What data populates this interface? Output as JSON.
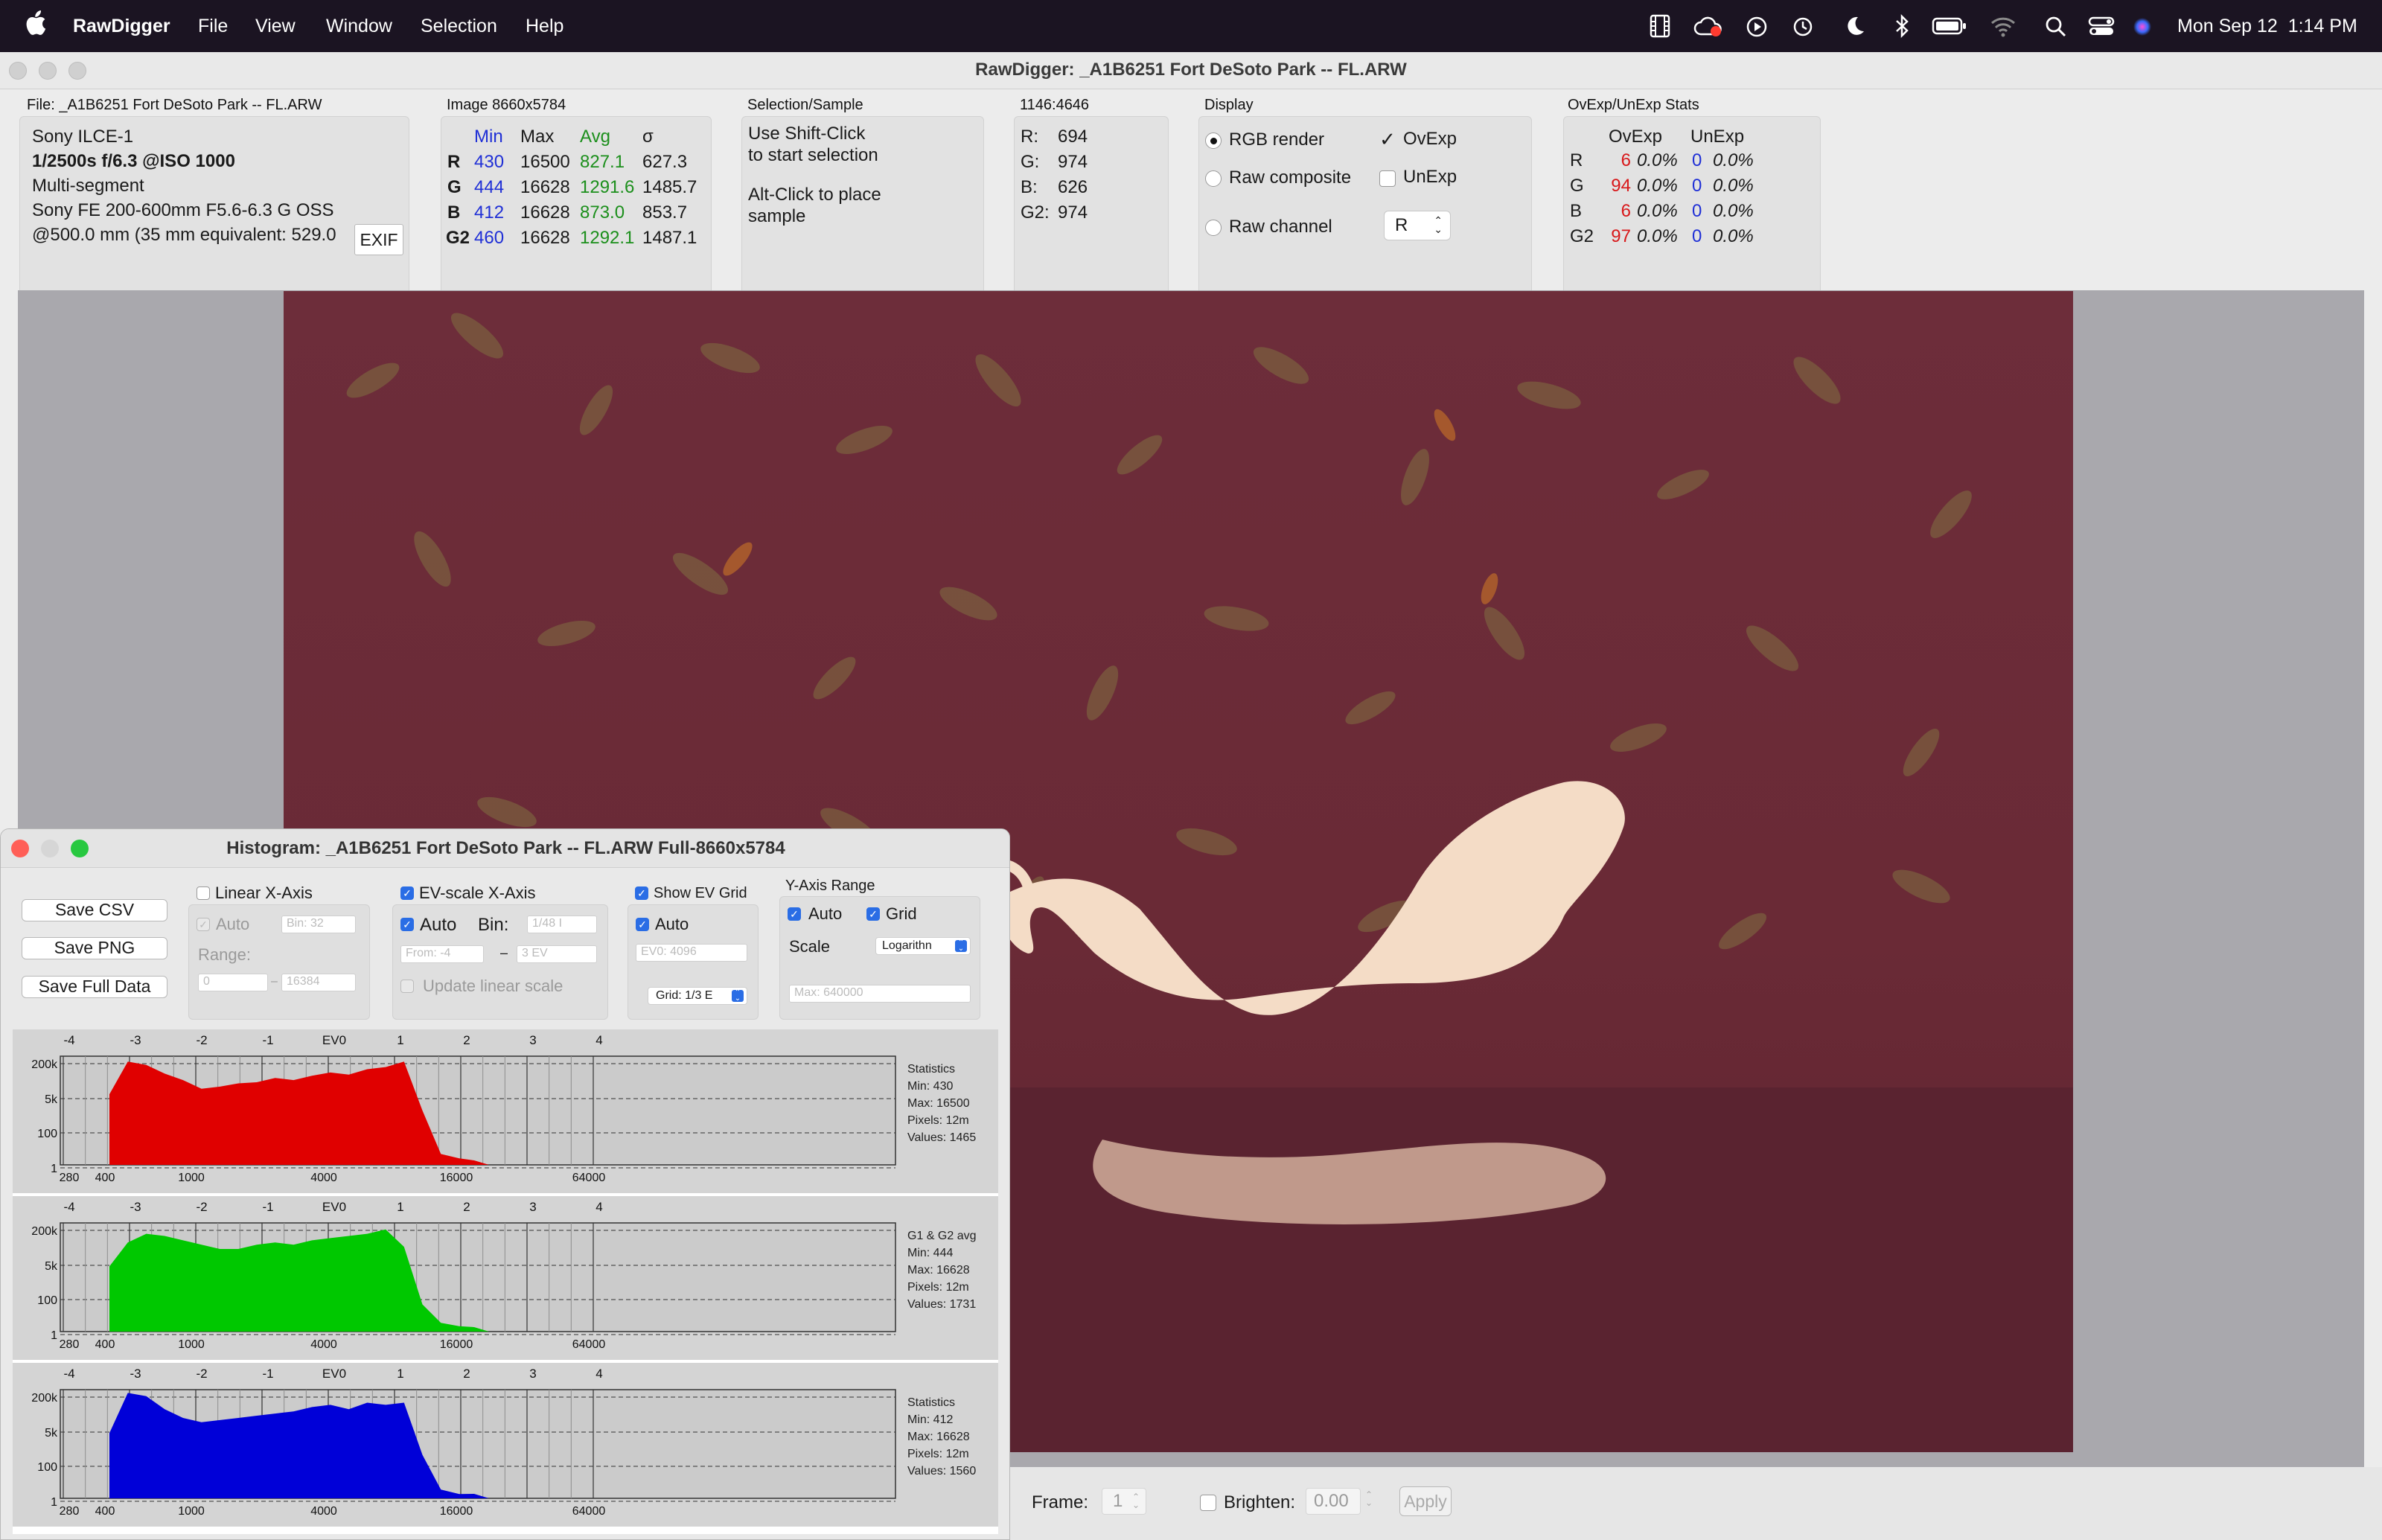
{
  "menubar": {
    "app": "RawDigger",
    "menus": [
      "File",
      "View",
      "Window",
      "Selection",
      "Help"
    ],
    "clock": "Mon Sep 12  1:14 PM"
  },
  "main": {
    "title": "RawDigger: _A1B6251 Fort DeSoto Park -- FL.ARW",
    "file_label": "File: _A1B6251 Fort DeSoto Park -- FL.ARW",
    "camera": "Sony ILCE-1",
    "exposure": "1/2500s f/6.3 @ISO 1000",
    "segment": "Multi-segment",
    "lens": "Sony FE 200-600mm F5.6-6.3 G OSS",
    "focal": "@500.0 mm (35 mm equivalent: 529.0",
    "exif_button": "EXIF",
    "image_label": "Image 8660x5784",
    "stats_headers": {
      "min": "Min",
      "max": "Max",
      "avg": "Avg",
      "sigma": "σ"
    },
    "stats_rows": [
      {
        "ch": "R",
        "min": "430",
        "max": "16500",
        "avg": "827.1",
        "sigma": "627.3"
      },
      {
        "ch": "G",
        "min": "444",
        "max": "16628",
        "avg": "1291.6",
        "sigma": "1485.7"
      },
      {
        "ch": "B",
        "min": "412",
        "max": "16628",
        "avg": "873.0",
        "sigma": "853.7"
      },
      {
        "ch": "G2",
        "min": "460",
        "max": "16628",
        "avg": "1292.1",
        "sigma": "1487.1"
      }
    ],
    "selection_label": "Selection/Sample",
    "sel_line1": "Use Shift-Click",
    "sel_line2": "to start selection",
    "sel_line3": "Alt-Click to place",
    "sel_line4": "sample",
    "coord_label": "1146:4646",
    "coord_vals": [
      {
        "k": "R:",
        "v": "694"
      },
      {
        "k": "G:",
        "v": "974"
      },
      {
        "k": "B:",
        "v": "626"
      },
      {
        "k": "G2:",
        "v": "974"
      }
    ],
    "display_label": "Display",
    "rgb_render": "RGB render",
    "raw_composite": "Raw composite",
    "raw_channel": "Raw channel",
    "ovexp": "OvExp",
    "unexp": "UnExp",
    "channel_select": "R",
    "ovunexp_label": "OvExp/UnExp Stats",
    "ov_headers": {
      "ov": "OvExp",
      "un": "UnExp"
    },
    "ov_rows": [
      {
        "ch": "R",
        "ovc": "6",
        "ovp": "0.0%",
        "unc": "0",
        "unp": "0.0%"
      },
      {
        "ch": "G",
        "ovc": "94",
        "ovp": "0.0%",
        "unc": "0",
        "unp": "0.0%"
      },
      {
        "ch": "B",
        "ovc": "6",
        "ovp": "0.0%",
        "unc": "0",
        "unp": "0.0%"
      },
      {
        "ch": "G2",
        "ovc": "97",
        "ovp": "0.0%",
        "unc": "0",
        "unp": "0.0%"
      }
    ]
  },
  "bottom": {
    "frame_label": "Frame:",
    "frame_value": "1",
    "brighten_label": "Brighten:",
    "brighten_value": "0.00",
    "apply": "Apply"
  },
  "hist": {
    "title": "Histogram: _A1B6251 Fort DeSoto Park -- FL.ARW Full-8660x5784",
    "save_csv": "Save CSV",
    "save_png": "Save PNG",
    "save_full": "Save Full Data",
    "linear_x": "Linear X-Axis",
    "auto": "Auto",
    "bin_32": "Bin: 32",
    "range_label": "Range:",
    "range_from": "0",
    "range_to": "16384",
    "ev_scale": "EV-scale X-Axis",
    "bin_label": "Bin:",
    "bin_ev": "1/48 I",
    "from_ev": "From: -4",
    "to_ev": "3 EV",
    "update_linear": "Update linear scale",
    "show_ev_grid": "Show EV Grid",
    "ev0_field": "EV0: 4096",
    "grid_select": "Grid: 1/3 E",
    "yaxis_label": "Y-Axis Range",
    "grid_label": "Grid",
    "scale_label": "Scale",
    "scale_select": "Logarithn",
    "max_field": "Max: 640000",
    "ev_ticks": [
      "-4",
      "-3",
      "-2",
      "-1",
      "EV0",
      "1",
      "2",
      "3",
      "4"
    ],
    "x_ticks": [
      "280",
      "400",
      "1000",
      "4000",
      "16000",
      "64000"
    ],
    "y_ticks": [
      "200k",
      "5k",
      "100",
      "1"
    ],
    "channels": [
      {
        "name": "red",
        "color": "#e00000",
        "head": "Statistics",
        "min": "Min: 430",
        "max": "Max: 16500",
        "pixels": "Pixels: 12m",
        "values": "Values: 1465"
      },
      {
        "name": "green",
        "color": "#00c800",
        "head": "G1 & G2 avg",
        "min": "Min: 444",
        "max": "Max: 16628",
        "pixels": "Pixels: 12m",
        "values": "Values: 1731"
      },
      {
        "name": "blue",
        "color": "#0000d8",
        "head": "Statistics",
        "min": "Min: 412",
        "max": "Max: 16628",
        "pixels": "Pixels: 12m",
        "values": "Values: 1560"
      }
    ]
  }
}
